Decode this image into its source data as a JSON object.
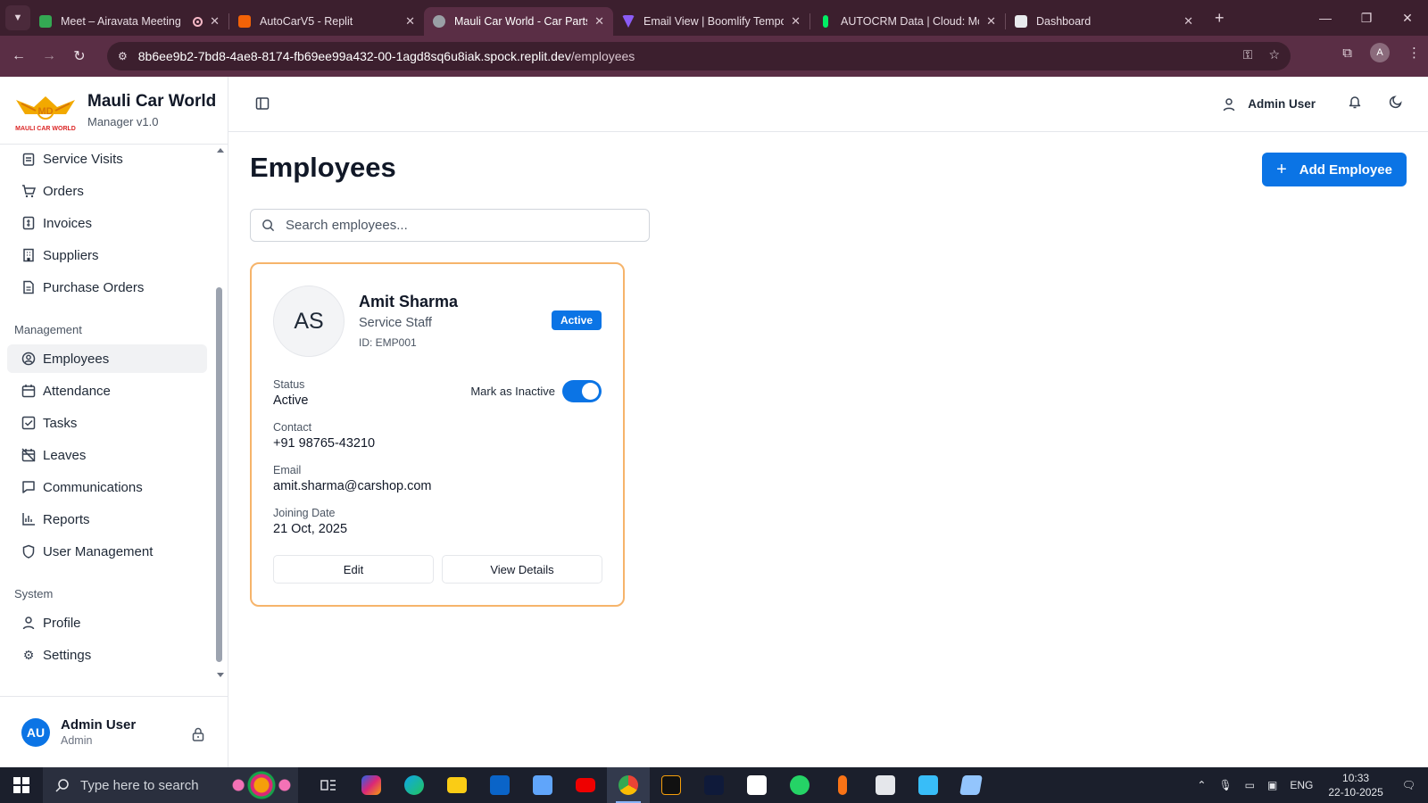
{
  "browser": {
    "tabs": [
      {
        "title": "Meet – Airavata Meeting",
        "color": "#34a853"
      },
      {
        "title": "AutoCarV5 - Replit",
        "color": "#f26207"
      },
      {
        "title": "Mauli Car World - Car Parts &",
        "color": "#9aa0a6"
      },
      {
        "title": "Email View | Boomlify Tempo",
        "color": "#8b5cf6"
      },
      {
        "title": "AUTOCRM Data | Cloud: Mo",
        "color": "#00ed64"
      },
      {
        "title": "Dashboard",
        "color": "#e8eaed"
      }
    ],
    "url_host": "8b6ee9b2-7bd8-4ae8-8174-fb69ee99a432-00-1agd8sq6u8iak.spock.replit.dev",
    "url_path": "/employees",
    "profile_initial": "A"
  },
  "sidebar": {
    "brand_name": "Mauli Car World",
    "brand_version": "Manager v1.0",
    "logo_text": "MD",
    "logo_subtext": "MAULI CAR WORLD",
    "items_top": [
      {
        "label": "Service Visits",
        "icon": "clipboard-icon"
      },
      {
        "label": "Orders",
        "icon": "cart-icon"
      },
      {
        "label": "Invoices",
        "icon": "invoice-icon"
      },
      {
        "label": "Suppliers",
        "icon": "building-icon"
      },
      {
        "label": "Purchase Orders",
        "icon": "file-icon"
      }
    ],
    "section_management": "Management",
    "items_management": [
      {
        "label": "Employees",
        "icon": "user-circle-icon"
      },
      {
        "label": "Attendance",
        "icon": "calendar-icon"
      },
      {
        "label": "Tasks",
        "icon": "checkbox-icon"
      },
      {
        "label": "Leaves",
        "icon": "calendar-off-icon"
      },
      {
        "label": "Communications",
        "icon": "message-icon"
      },
      {
        "label": "Reports",
        "icon": "bar-chart-icon"
      },
      {
        "label": "User Management",
        "icon": "shield-icon"
      }
    ],
    "section_system": "System",
    "items_system": [
      {
        "label": "Profile",
        "icon": "user-icon"
      },
      {
        "label": "Settings",
        "icon": "gear-icon"
      }
    ],
    "user": {
      "initials": "AU",
      "name": "Admin User",
      "role": "Admin"
    }
  },
  "header": {
    "user_name": "Admin User"
  },
  "main": {
    "title": "Employees",
    "add_button": "Add Employee",
    "search_placeholder": "Search employees..."
  },
  "employee": {
    "initials": "AS",
    "name": "Amit Sharma",
    "role": "Service Staff",
    "id_text": "ID: EMP001",
    "badge": "Active",
    "status_label": "Status",
    "status_value": "Active",
    "toggle_label": "Mark as Inactive",
    "contact_label": "Contact",
    "contact_value": "+91 98765-43210",
    "email_label": "Email",
    "email_value": "amit.sharma@carshop.com",
    "joining_label": "Joining Date",
    "joining_value": "21 Oct, 2025",
    "edit_button": "Edit",
    "view_button": "View Details"
  },
  "taskbar": {
    "search_text": "Type here to search",
    "lang": "ENG",
    "time": "10:33",
    "date": "22-10-2025"
  },
  "colors": {
    "accent": "#0b74e5",
    "card_border": "#f6b46b"
  }
}
